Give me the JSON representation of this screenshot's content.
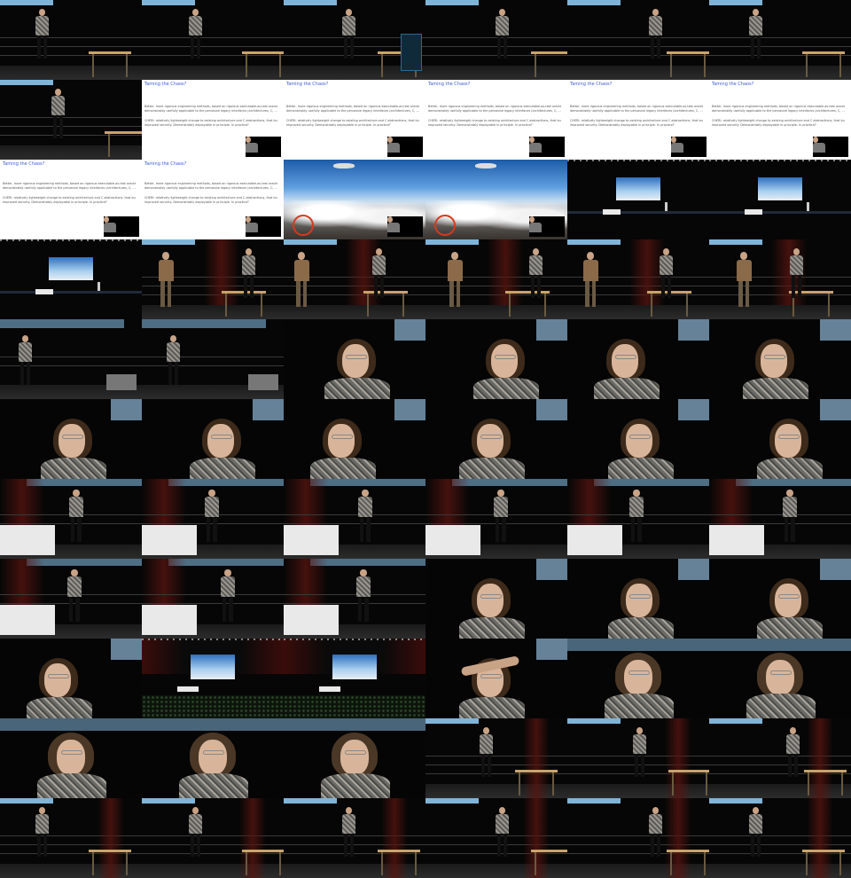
{
  "slide": {
    "title": "Taming the Chaos?",
    "line1": "Better, more rigorous engineering methods, based on rigorous executable-as-test oracle specs,",
    "line2": "demonstrably usefully applicable to the pervasive legacy interfaces (architectures, C, ...)",
    "line3": "CHERI: relatively lightweight change to existing architecture and C abstractions, that builds in",
    "line4": "improved security. Demonstrably deployable in principle. In practice?"
  },
  "tiles": [
    "stage",
    "stage",
    "stage-banner",
    "stage",
    "stage",
    "stage",
    "stage",
    "slide",
    "slide-line",
    "slide",
    "slide",
    "slide",
    "slide-full",
    "slide-full",
    "sky",
    "sky",
    "hall",
    "hall",
    "hall-far",
    "two",
    "two",
    "two",
    "two",
    "two",
    "walk",
    "walk",
    "close",
    "close",
    "close",
    "close",
    "close",
    "close",
    "close",
    "close",
    "close",
    "close",
    "stand",
    "stand",
    "stand",
    "stand",
    "stand",
    "stand",
    "stand",
    "stand",
    "stand",
    "close",
    "close",
    "close",
    "close",
    "hall-wide",
    "hall-wide",
    "salute",
    "front",
    "front",
    "front",
    "front",
    "front",
    "stage",
    "stage",
    "stage",
    "stage",
    "stage",
    "stage",
    "stage",
    "stage",
    "stage"
  ]
}
